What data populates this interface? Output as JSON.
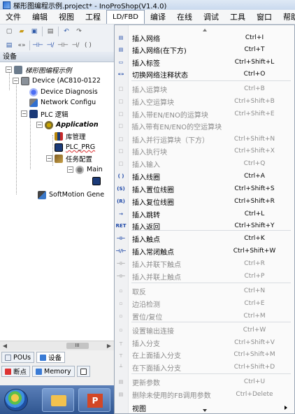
{
  "window": {
    "title": "梯形图编程示例.project* - InoProShop(V1.4.0)"
  },
  "menubar": {
    "items": [
      "文件",
      "编辑",
      "视图",
      "工程",
      "LD/FBD",
      "编译",
      "在线",
      "调试",
      "工具",
      "窗口",
      "帮助"
    ],
    "active": "LD/FBD"
  },
  "devices_panel": {
    "title": "设备",
    "tree": {
      "project": "梯形图编程示例",
      "device": "Device (AC810-0122",
      "device_diagnosis": "Device Diagnosis",
      "network_config": "Network Configu",
      "plc_logic": "PLC 逻辑",
      "application": "Application",
      "library_manager": "库管理",
      "plc_prg": "PLC_PRG",
      "task_config": "任务配置",
      "main_task": "Main",
      "softmotion": "SoftMotion Gene"
    },
    "scroll_thumb": "III",
    "tabs": [
      "POUs",
      "设备"
    ],
    "bottom_tabs": [
      "断点",
      "Memory"
    ]
  },
  "dropdown": {
    "items": [
      {
        "icon": "insert-network-icon",
        "label": "插入网络",
        "shortcut": "Ctrl+I",
        "enabled": true
      },
      {
        "icon": "insert-network-below-icon",
        "label": "插入网络(在下方)",
        "shortcut": "Ctrl+T",
        "enabled": true
      },
      {
        "icon": "insert-label-icon",
        "label": "插入标签",
        "shortcut": "Ctrl+Shift+L",
        "enabled": true
      },
      {
        "icon": "toggle-comment-icon",
        "label": "切换网络注释状态",
        "shortcut": "Ctrl+O",
        "enabled": true
      },
      {
        "icon": "insert-box-icon",
        "label": "插入运算块",
        "shortcut": "Ctrl+B",
        "enabled": false
      },
      {
        "icon": "insert-empty-box-icon",
        "label": "插入空运算块",
        "shortcut": "Ctrl+Shift+B",
        "enabled": false
      },
      {
        "icon": "insert-box-en-icon",
        "label": "插入带EN/ENO的运算块",
        "shortcut": "Ctrl+Shift+E",
        "enabled": false
      },
      {
        "icon": "insert-empty-box-en-icon",
        "label": "插入带有EN/ENO的空运算块",
        "shortcut": "",
        "enabled": false
      },
      {
        "icon": "insert-parallel-box-icon",
        "label": "插入并行运算块（下方）",
        "shortcut": "Ctrl+Shift+N",
        "enabled": false
      },
      {
        "icon": "insert-exec-box-icon",
        "label": "插入执行块",
        "shortcut": "Ctrl+Shift+X",
        "enabled": false
      },
      {
        "icon": "insert-input-icon",
        "label": "插入输入",
        "shortcut": "Ctrl+Q",
        "enabled": false
      },
      {
        "icon": "insert-coil-icon",
        "label": "插入线圈",
        "shortcut": "Ctrl+A",
        "enabled": true
      },
      {
        "icon": "insert-set-coil-icon",
        "label": "插入置位线圈",
        "shortcut": "Ctrl+Shift+S",
        "enabled": true
      },
      {
        "icon": "insert-reset-coil-icon",
        "label": "插入复位线圈",
        "shortcut": "Ctrl+Shift+R",
        "enabled": true
      },
      {
        "icon": "insert-jump-icon",
        "label": "插入跳转",
        "shortcut": "Ctrl+L",
        "enabled": true
      },
      {
        "icon": "insert-return-icon",
        "label": "插入返回",
        "shortcut": "Ctrl+Shift+Y",
        "enabled": true
      },
      {
        "icon": "insert-contact-icon",
        "label": "插入触点",
        "shortcut": "Ctrl+K",
        "enabled": true
      },
      {
        "icon": "insert-nc-contact-icon",
        "label": "插入常闭触点",
        "shortcut": "Ctrl+Shift+W",
        "enabled": true
      },
      {
        "icon": "insert-parallel-below-contact-icon",
        "label": "插入并联下触点",
        "shortcut": "Ctrl+R",
        "enabled": false
      },
      {
        "icon": "insert-parallel-above-contact-icon",
        "label": "插入并联上触点",
        "shortcut": "Ctrl+P",
        "enabled": false
      },
      {
        "icon": "negate-icon",
        "label": "取反",
        "shortcut": "Ctrl+N",
        "enabled": false
      },
      {
        "icon": "edge-detect-icon",
        "label": "边沿检测",
        "shortcut": "Ctrl+E",
        "enabled": false
      },
      {
        "icon": "set-reset-icon",
        "label": "置位/复位",
        "shortcut": "Ctrl+M",
        "enabled": false
      },
      {
        "icon": "output-connection-icon",
        "label": "设置输出连接",
        "shortcut": "Ctrl+W",
        "enabled": false
      },
      {
        "icon": "insert-branch-icon",
        "label": "插入分支",
        "shortcut": "Ctrl+Shift+V",
        "enabled": false
      },
      {
        "icon": "insert-branch-above-icon",
        "label": "在上面插入分支",
        "shortcut": "Ctrl+Shift+M",
        "enabled": false
      },
      {
        "icon": "insert-branch-below-icon",
        "label": "在下面插入分支",
        "shortcut": "Ctrl+Shift+D",
        "enabled": false
      },
      {
        "icon": "update-params-icon",
        "label": "更新参数",
        "shortcut": "Ctrl+U",
        "enabled": false
      },
      {
        "icon": "remove-unused-params-icon",
        "label": "删除未使用的FB调用参数",
        "shortcut": "Ctrl+Delete",
        "enabled": false
      },
      {
        "icon": "",
        "label": "视图",
        "shortcut": "",
        "enabled": true,
        "submenu": true
      }
    ],
    "icon_glyphs": {
      "insert-network-icon": "▤",
      "insert-network-below-icon": "▤",
      "insert-label-icon": "▭",
      "toggle-comment-icon": "«»",
      "insert-box-icon": "□",
      "insert-empty-box-icon": "□",
      "insert-box-en-icon": "□",
      "insert-empty-box-en-icon": "□",
      "insert-parallel-box-icon": "□",
      "insert-exec-box-icon": "□",
      "insert-input-icon": "□",
      "insert-coil-icon": "( )",
      "insert-set-coil-icon": "(S)",
      "insert-reset-coil-icon": "(R)",
      "insert-jump-icon": "→",
      "insert-return-icon": "RET",
      "insert-contact-icon": "⊣⊢",
      "insert-nc-contact-icon": "⊣/⊢",
      "insert-parallel-below-contact-icon": "⊣⊢",
      "insert-parallel-above-contact-icon": "⊣⊢",
      "negate-icon": "▫",
      "edge-detect-icon": "▫",
      "set-reset-icon": "▫",
      "output-connection-icon": "▫",
      "insert-branch-icon": "┬",
      "insert-branch-above-icon": "┬",
      "insert-branch-below-icon": "┴",
      "update-params-icon": "▤",
      "remove-unused-params-icon": "▤"
    }
  }
}
